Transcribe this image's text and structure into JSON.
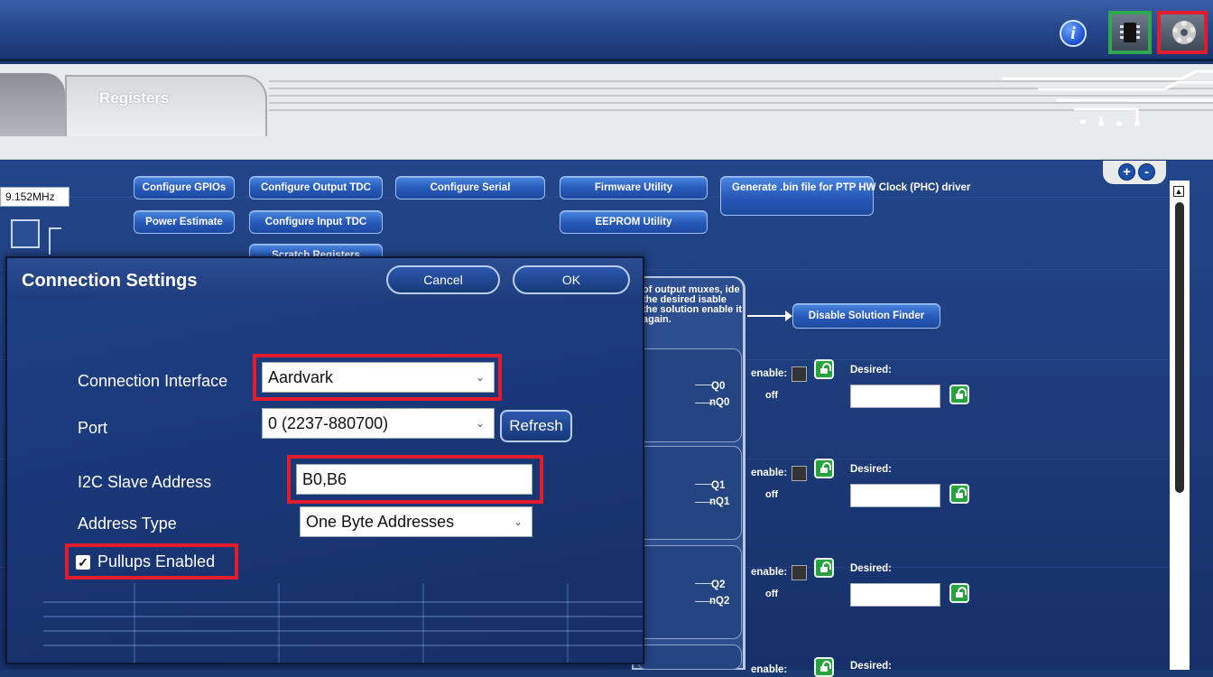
{
  "topbar": {
    "info_icon": "info-icon",
    "chip_icon": "chip-icon",
    "gear_icon": "gear-icon"
  },
  "tabs": {
    "registers_label": "Registers"
  },
  "canvas": {
    "frequency_value": "9.152MHz",
    "buttons": {
      "configure_gpios": "Configure GPIOs",
      "configure_output_tdc": "Configure Output TDC",
      "configure_serial": "Configure Serial",
      "firmware_utility": "Firmware Utility",
      "generate_bin": "Generate .bin file for PTP HW Clock (PHC) driver",
      "power_estimate": "Power Estimate",
      "configure_input_tdc": "Configure Input TDC",
      "eeprom_utility": "EEPROM Utility",
      "scratch_registers": "Scratch Registers",
      "disable_solution_finder": "Disable Solution Finder"
    },
    "finder_text": "of output muxes, ide the desired isable the solution enable it again.",
    "outputs": [
      {
        "q": "Q0",
        "nq": "nQ0",
        "enable_label": "enable:",
        "off_label": "off",
        "desired_label": "Desired:"
      },
      {
        "q": "Q1",
        "nq": "nQ1",
        "enable_label": "enable:",
        "off_label": "off",
        "desired_label": "Desired:"
      },
      {
        "q": "Q2",
        "nq": "nQ2",
        "enable_label": "enable:",
        "off_label": "off",
        "desired_label": "Desired:"
      },
      {
        "q": "",
        "nq": "",
        "enable_label": "enable:",
        "off_label": "",
        "desired_label": "Desired:"
      }
    ],
    "zoom_plus": "+",
    "zoom_minus": "-"
  },
  "dialog": {
    "title": "Connection Settings",
    "cancel_label": "Cancel",
    "ok_label": "OK",
    "connection_interface_label": "Connection Interface",
    "connection_interface_value": "Aardvark",
    "port_label": "Port",
    "port_value": "0   (2237-880700)",
    "refresh_label": "Refresh",
    "slave_address_label": "I2C Slave Address",
    "slave_address_value": "B0,B6",
    "address_type_label": "Address Type",
    "address_type_value": "One Byte Addresses",
    "pullups_label": "Pullups Enabled",
    "pullups_checked": true
  },
  "colors": {
    "highlight_red": "#e21c2c",
    "highlight_green": "#2fa94e",
    "accent_blue": "#2658b8"
  }
}
